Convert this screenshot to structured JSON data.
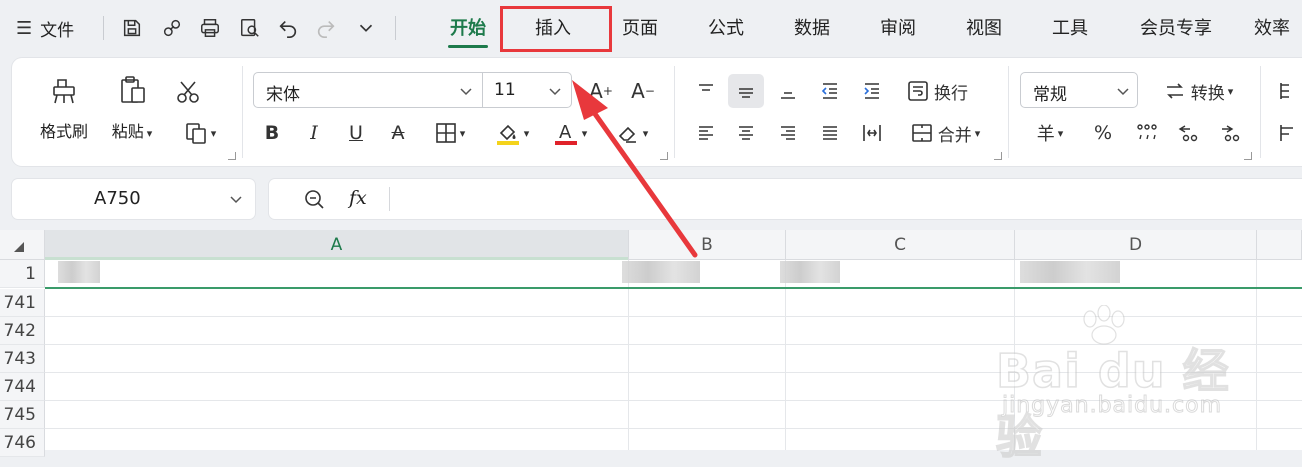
{
  "menubar": {
    "file_label": "文件",
    "tabs": [
      {
        "label": "开始",
        "active": true
      },
      {
        "label": "插入",
        "active": false
      },
      {
        "label": "页面",
        "active": false
      },
      {
        "label": "公式",
        "active": false
      },
      {
        "label": "数据",
        "active": false
      },
      {
        "label": "审阅",
        "active": false
      },
      {
        "label": "视图",
        "active": false
      },
      {
        "label": "工具",
        "active": false
      },
      {
        "label": "会员专享",
        "active": false
      },
      {
        "label": "效率",
        "active": false
      }
    ],
    "active_color": "#1d7a4b"
  },
  "ribbon": {
    "format_painter_label": "格式刷",
    "paste_label": "粘贴",
    "font_name": "宋体",
    "font_size": "11",
    "wrap_label": "换行",
    "merge_label": "合并",
    "number_format": "常规",
    "convert_label": "转换",
    "currency_symbol": "羊",
    "percent_symbol": "%"
  },
  "formula_bar": {
    "cell_reference": "A750",
    "fx_label": "fx"
  },
  "sheet": {
    "columns": [
      "A",
      "B",
      "C",
      "D"
    ],
    "rows": [
      "1",
      "741",
      "742",
      "743",
      "744",
      "745",
      "746"
    ]
  },
  "watermark": {
    "main": "Bai du 经验",
    "sub": "jingyan.baidu.com"
  },
  "annotation_color": "#e8383c"
}
